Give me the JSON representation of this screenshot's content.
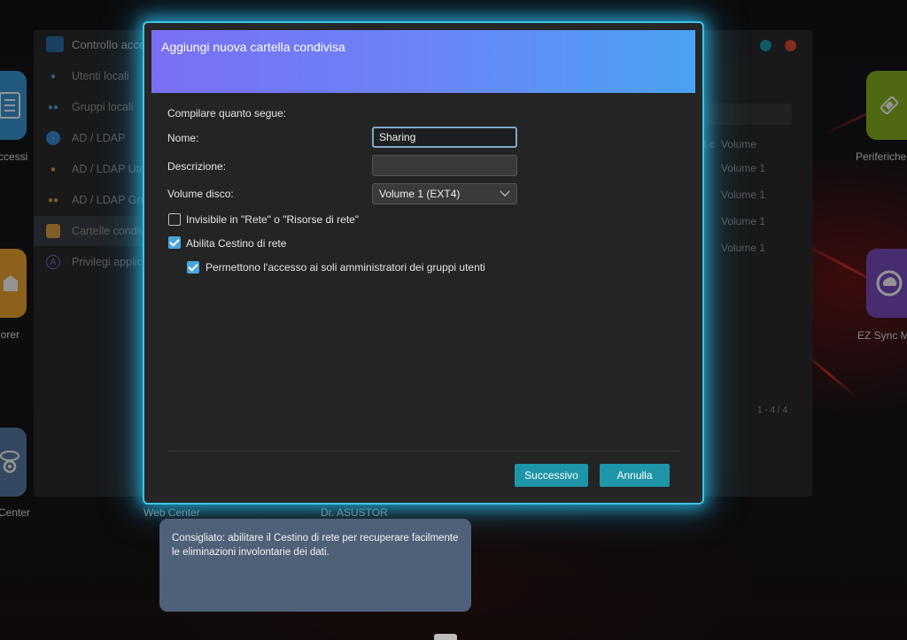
{
  "desktop": {
    "icons_left": [
      {
        "label": "ccessi",
        "color": "#3a9ad9",
        "icon": "document-icon"
      },
      {
        "label": "lorer",
        "color": "#f0a830",
        "icon": "folder-icon"
      },
      {
        "label": "Center",
        "color": "#5a7fa8",
        "icon": "camera-icon"
      }
    ],
    "icons_right": [
      {
        "label": "Periferiche",
        "color": "#8ab420",
        "icon": "usb-icon"
      },
      {
        "label": "EZ Sync M",
        "color": "#7b4fc0",
        "icon": "sync-icon"
      }
    ],
    "bottom_labels": [
      "Web Center",
      "Dr. ASUSTOR"
    ]
  },
  "background_window": {
    "title": "Controllo acces",
    "sidebar": [
      {
        "label": "Utenti locali",
        "icon": "user-icon",
        "active": false
      },
      {
        "label": "Gruppi locali",
        "icon": "group-icon",
        "active": false
      },
      {
        "label": "AD / LDAP",
        "icon": "ldap-icon",
        "active": false
      },
      {
        "label": "AD / LDAP Uten",
        "icon": "user-icon",
        "active": false
      },
      {
        "label": "AD / LDAP Grup",
        "icon": "group-icon",
        "active": false
      },
      {
        "label": "Cartelle condivis",
        "icon": "shared-folder-icon",
        "active": true
      },
      {
        "label": "Privilegi applicaz",
        "icon": "app-privilege-icon",
        "active": false
      }
    ],
    "table_header": [
      "el c",
      "Volume"
    ],
    "table_rows": [
      "Volume 1",
      "Volume 1",
      "Volume 1",
      "Volume 1"
    ],
    "pager": "1 - 4 / 4"
  },
  "dialog": {
    "title": "Aggiungi nuova cartella condivisa",
    "intro": "Compilare quanto segue:",
    "name_label": "Nome:",
    "name_value": "Sharing",
    "description_label": "Descrizione:",
    "description_value": "",
    "volume_label": "Volume disco:",
    "volume_value": "Volume 1 (EXT4)",
    "checkbox_invisible": "Invisibile in \"Rete\" o \"Risorse di rete\"",
    "checkbox_invisible_checked": false,
    "checkbox_recycle": "Abilita Cestino di rete",
    "checkbox_recycle_checked": true,
    "checkbox_admin_only": "Permettono l'accesso ai soli amministratori dei gruppi utenti",
    "checkbox_admin_only_checked": true,
    "next_button": "Successivo",
    "cancel_button": "Annulla"
  },
  "tooltip": {
    "text": "Consigliato: abilitare il Cestino di rete per recuperare facilmente le eliminazioni involontarie dei dati."
  },
  "colors": {
    "accent": "#1f95a8",
    "header_gradient_start": "#7a6ff3",
    "header_gradient_end": "#4aa2f3",
    "glow": "#3dc4e8",
    "checkbox": "#4aa6d8",
    "tooltip_bg": "#4f6079"
  }
}
